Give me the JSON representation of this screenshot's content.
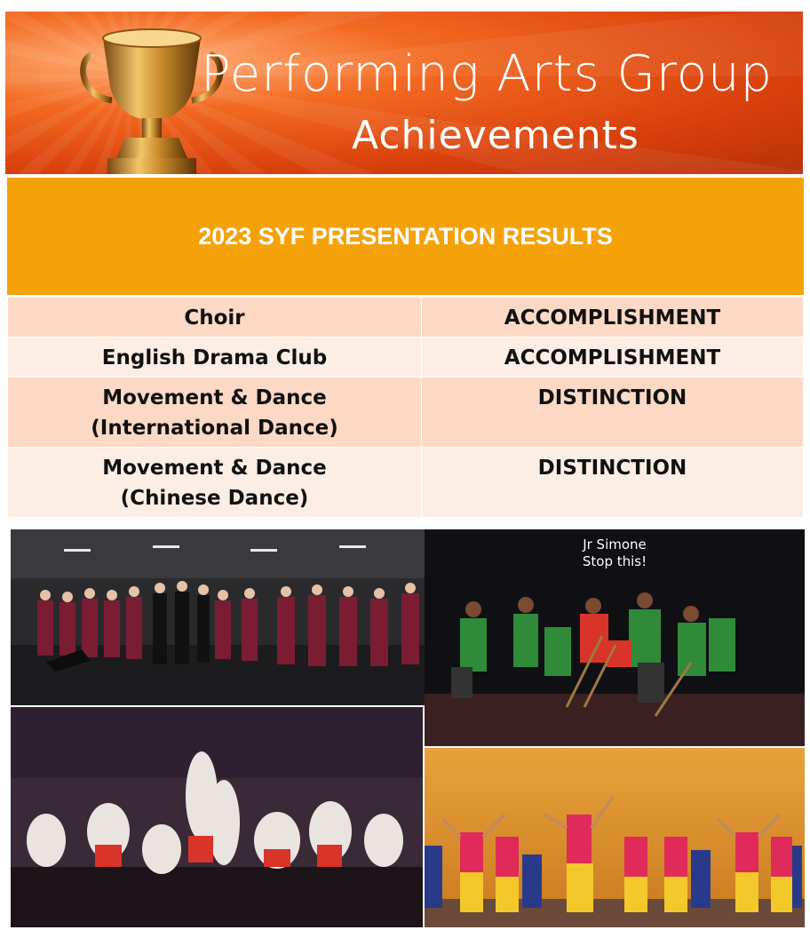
{
  "banner": {
    "title": "Performing Arts Group",
    "subtitle": "Achievements",
    "icon": "trophy-icon"
  },
  "results": {
    "heading": "2023 SYF PRESENTATION RESULTS",
    "rows": [
      {
        "group": [
          "Choir"
        ],
        "award": "ACCOMPLISHMENT"
      },
      {
        "group": [
          "English Drama Club"
        ],
        "award": "ACCOMPLISHMENT"
      },
      {
        "group": [
          "Movement & Dance",
          "(International Dance)"
        ],
        "award": "DISTINCTION"
      },
      {
        "group": [
          "Movement & Dance",
          "(Chinese Dance)"
        ],
        "award": "DISTINCTION"
      }
    ]
  },
  "photos": {
    "drama_caption": [
      "Jr Simone",
      "Stop this!"
    ]
  },
  "colors": {
    "banner_orange": "#f36a22",
    "header_orange": "#f5a20a",
    "row_dark": "#fbd9c5",
    "row_light": "#fdeee5"
  }
}
